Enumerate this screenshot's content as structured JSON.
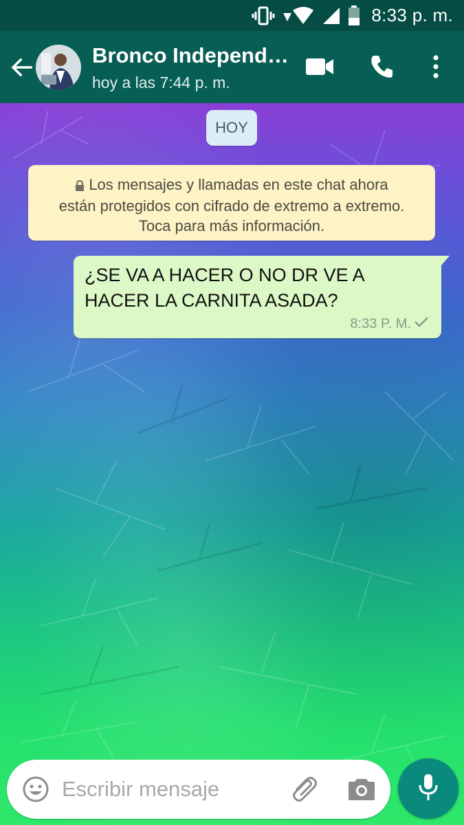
{
  "status_bar": {
    "time": "8:33 p. m.",
    "icons": [
      "vibrate-icon",
      "wifi-icon",
      "signal-icon",
      "battery-icon"
    ]
  },
  "header": {
    "contact_name": "Bronco Independ…",
    "last_seen": "hoy a las 7:44 p. m.",
    "icons": [
      "back-arrow-icon",
      "video-call-icon",
      "phone-call-icon",
      "more-options-icon"
    ],
    "color": "#075e54"
  },
  "chat": {
    "date_chip": "HOY",
    "encryption_notice": {
      "line1": "Los mensajes y llamadas en este chat ahora",
      "line2": "están protegidos con cifrado de extremo a extremo.",
      "line3": "Toca para más información."
    },
    "messages": [
      {
        "direction": "outgoing",
        "text": "¿SE VA A HACER O NO DR VE A HACER LA CARNITA ASADA?",
        "time": "8:33 P. M.",
        "status": "sent"
      }
    ]
  },
  "composer": {
    "placeholder": "Escribir mensaje",
    "value": "",
    "icons": [
      "emoji-icon",
      "attach-icon",
      "camera-icon",
      "mic-icon"
    ],
    "mic_color": "#0a8a7c"
  }
}
